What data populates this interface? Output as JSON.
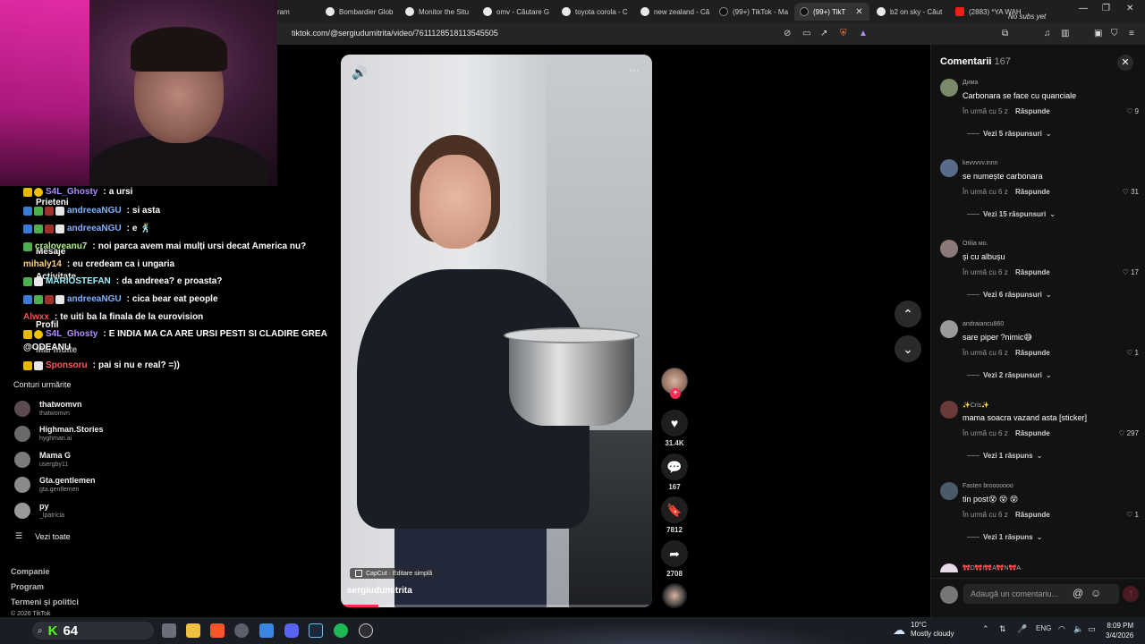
{
  "browser": {
    "tabs": [
      {
        "label": "ram",
        "active": false
      },
      {
        "label": "Bombardier Glob",
        "active": false
      },
      {
        "label": "Monitor the Situ",
        "active": false
      },
      {
        "label": "omv - Căutare G",
        "active": false
      },
      {
        "label": "toyota corola - C",
        "active": false
      },
      {
        "label": "new zealand - Că",
        "active": false
      },
      {
        "label": "(99+) TikTok - Ma",
        "active": false
      },
      {
        "label": "(99+) TikT",
        "active": true
      },
      {
        "label": "b2 on sky - Căut",
        "active": false
      },
      {
        "label": "(2883) *YA WAH",
        "active": false
      }
    ],
    "overlay_note": "No subs yet",
    "url": "tiktok.com/@sergiudumitrita/video/7611128518113545505",
    "accent": "#fe2c55"
  },
  "chat": [
    {
      "user": "S4L_Ghosty",
      "message": "a ursi",
      "color": "#b18cff"
    },
    {
      "user": "andreeaNGU",
      "message": "si asta",
      "color": "#7fb2ff"
    },
    {
      "user": "andreeaNGU",
      "message": "e",
      "color": "#7fb2ff"
    },
    {
      "user": "craloveanu7",
      "message": "noi parca avem mai mulți ursi decat America nu?",
      "color": "#b6f28c"
    },
    {
      "user": "mihaly14",
      "message": "eu credeam ca i ungaria",
      "color": "#ffd27a"
    },
    {
      "user": "MARIOSTEFAN",
      "message": "da andreea? e proasta?",
      "color": "#9cf5ff"
    },
    {
      "user": "andreeaNGU",
      "message": "cica bear eat people",
      "color": "#7fb2ff"
    },
    {
      "user": "Alwxx",
      "message": "te uiti ba la finala de la eurovision",
      "color": "#ff4f4f"
    },
    {
      "user": "S4L_Ghosty",
      "message": "E INDIA MA CA ARE URSI PESTI SI CLADIRE GREA",
      "color": "#b18cff"
    },
    {
      "user": "Sponsoru",
      "message": "pai si nu e real? =))",
      "color": "#ff5b5b"
    }
  ],
  "sidebar": {
    "nav": [
      "Prieteni",
      "Activitate",
      "Mesaje",
      "Profil",
      "Mai multe"
    ],
    "mention": "@ODEANU",
    "following_title": "Conturi urmărite",
    "accounts": [
      {
        "name": "thatwomvn",
        "handle": "thatwomvn"
      },
      {
        "name": "Highman.Stories",
        "handle": "hyghman.ai"
      },
      {
        "name": "Mama G",
        "handle": "usergby11"
      },
      {
        "name": "Gta.gentlemen",
        "handle": "gta.gentlemen"
      },
      {
        "name": "py",
        "handle": "_lpatricia"
      }
    ],
    "see_all": "Vezi toate",
    "footer": [
      "Companie",
      "Program",
      "Termeni și politici",
      "© 2026 TikTok"
    ]
  },
  "video": {
    "author": "sergiudumitrita",
    "capcut_label": "CapCut · Editare simplă",
    "likes": "31.4K",
    "comments": "167",
    "saves": "7812",
    "shares": "2708",
    "progress": 0.12
  },
  "comments_panel": {
    "title": "Comentarii",
    "count": "167",
    "items": [
      {
        "user": "Дима",
        "text": "Carbonara se face cu quanciale",
        "time": "În urmă cu 5 z",
        "reply": "Răspunde",
        "likes": "9",
        "view": "Vezi 5 răspunsuri"
      },
      {
        "user": "kevvvvv.innn",
        "text": "se numește carbonara",
        "time": "În urmă cu 6 z",
        "reply": "Răspunde",
        "likes": "31",
        "view": "Vezi 15 răspunsuri"
      },
      {
        "user": "Otilia мо.",
        "text": "și cu albușu",
        "time": "În urmă cu 6 z",
        "reply": "Răspunde",
        "likes": "17",
        "view": "Vezi 6 răspunsuri"
      },
      {
        "user": "andraiancu860",
        "text": "sare piper ?nimic😅",
        "time": "În urmă cu 6 z",
        "reply": "Răspunde",
        "likes": "1",
        "view": "Vezi 2 răspunsuri"
      },
      {
        "user": "✨Cris✨",
        "text": "mama soacra vazand asta [sticker]",
        "time": "În urmă cu 6 z",
        "reply": "Răspunde",
        "likes": "297",
        "view": "Vezi 1 răspuns"
      },
      {
        "user": "Fasten brooooooo",
        "text": "tin post😵 😵 😵",
        "time": "În urmă cu 6 z",
        "reply": "Răspunde",
        "likes": "1",
        "view": "Vezi 1 răspuns"
      }
    ],
    "partial_user": "🎀D🎀I🎀A🎀N🎀A",
    "input_placeholder": "Adaugă un comentariu..."
  },
  "taskbar": {
    "live_count": "64",
    "weather_temp": "10°C",
    "weather_desc": "Mostly cloudy",
    "lang": "ENG",
    "time": "8:09 PM",
    "date": "3/4/2026"
  }
}
